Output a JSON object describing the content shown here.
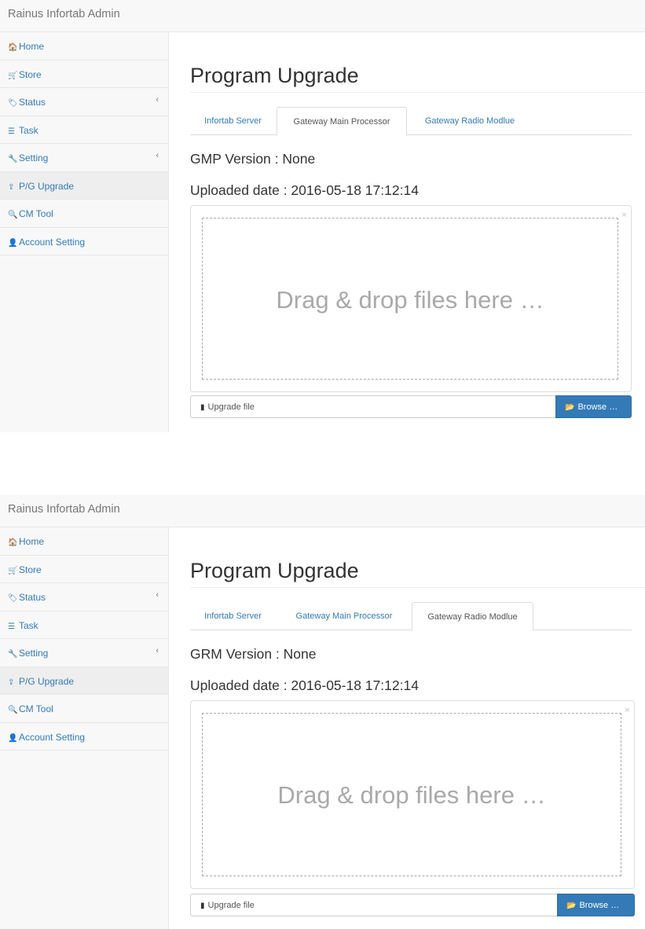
{
  "shot1": {
    "brand": "Rainus Infortab Admin",
    "sidebar": [
      {
        "icon": "home-icon",
        "glyph": "🏠",
        "label": "Home",
        "chevron": ""
      },
      {
        "icon": "cart-icon",
        "glyph": "🛒",
        "label": "Store",
        "chevron": ""
      },
      {
        "icon": "tags-icon",
        "glyph": "🏷",
        "label": "Status",
        "chevron": "‹"
      },
      {
        "icon": "list-icon",
        "glyph": "☰",
        "label": "Task",
        "chevron": ""
      },
      {
        "icon": "wrench-icon",
        "glyph": "🔧",
        "label": "Setting",
        "chevron": "‹"
      },
      {
        "icon": "upload-icon",
        "glyph": "⇪",
        "label": "P/G Upgrade",
        "chevron": ""
      },
      {
        "icon": "search-icon",
        "glyph": "🔍",
        "label": "CM Tool",
        "chevron": ""
      },
      {
        "icon": "user-icon",
        "glyph": "👤",
        "label": "Account Setting",
        "chevron": ""
      }
    ],
    "page_title": "Program Upgrade",
    "tabs": [
      "Infortab Server",
      "Gateway Main Processor",
      "Gateway Radio Modlue"
    ],
    "active_tab": "Gateway Main Processor",
    "version": "GMP Version : None",
    "uploaded": "Uploaded date : 2016-05-18 17:12:14",
    "drop_text": "Drag & drop files here …",
    "close": "×",
    "file_placeholder": "Upgrade file",
    "browse_label": "Browse …"
  },
  "shot2": {
    "brand": "Rainus Infortab Admin",
    "sidebar": [
      {
        "icon": "home-icon",
        "glyph": "🏠",
        "label": "Home",
        "chevron": ""
      },
      {
        "icon": "cart-icon",
        "glyph": "🛒",
        "label": "Store",
        "chevron": ""
      },
      {
        "icon": "tags-icon",
        "glyph": "🏷",
        "label": "Status",
        "chevron": "‹"
      },
      {
        "icon": "list-icon",
        "glyph": "☰",
        "label": "Task",
        "chevron": ""
      },
      {
        "icon": "wrench-icon",
        "glyph": "🔧",
        "label": "Setting",
        "chevron": "‹"
      },
      {
        "icon": "upload-icon",
        "glyph": "⇪",
        "label": "P/G Upgrade",
        "chevron": ""
      },
      {
        "icon": "search-icon",
        "glyph": "🔍",
        "label": "CM Tool",
        "chevron": ""
      },
      {
        "icon": "user-icon",
        "glyph": "👤",
        "label": "Account Setting",
        "chevron": ""
      }
    ],
    "page_title": "Program Upgrade",
    "tabs": [
      "Infortab Server",
      "Gateway Main Processor",
      "Gateway Radio Modlue"
    ],
    "active_tab": "Gateway Radio Modlue",
    "version": "GRM Version : None",
    "uploaded": "Uploaded date : 2016-05-18 17:12:14",
    "drop_text": "Drag & drop files here …",
    "close": "×",
    "file_placeholder": "Upgrade file",
    "browse_label": "Browse …"
  },
  "colors": {
    "accent": "#337ab7",
    "sidebar_bg": "#f8f8f8",
    "active_item_bg": "#eeeeee",
    "drop_text": "#a9a9a9"
  }
}
